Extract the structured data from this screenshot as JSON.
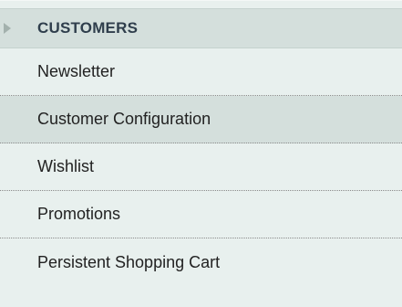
{
  "section": {
    "title": "CUSTOMERS",
    "icon": "triangle-right-icon"
  },
  "menu": {
    "items": [
      {
        "label": "Newsletter",
        "active": false
      },
      {
        "label": "Customer Configuration",
        "active": true
      },
      {
        "label": "Wishlist",
        "active": false
      },
      {
        "label": "Promotions",
        "active": false
      },
      {
        "label": "Persistent Shopping Cart",
        "active": false
      }
    ]
  },
  "colors": {
    "background": "#e8f0ee",
    "active_background": "#d4dfdc",
    "header_text": "#2f3e4c",
    "item_text": "#222222"
  }
}
